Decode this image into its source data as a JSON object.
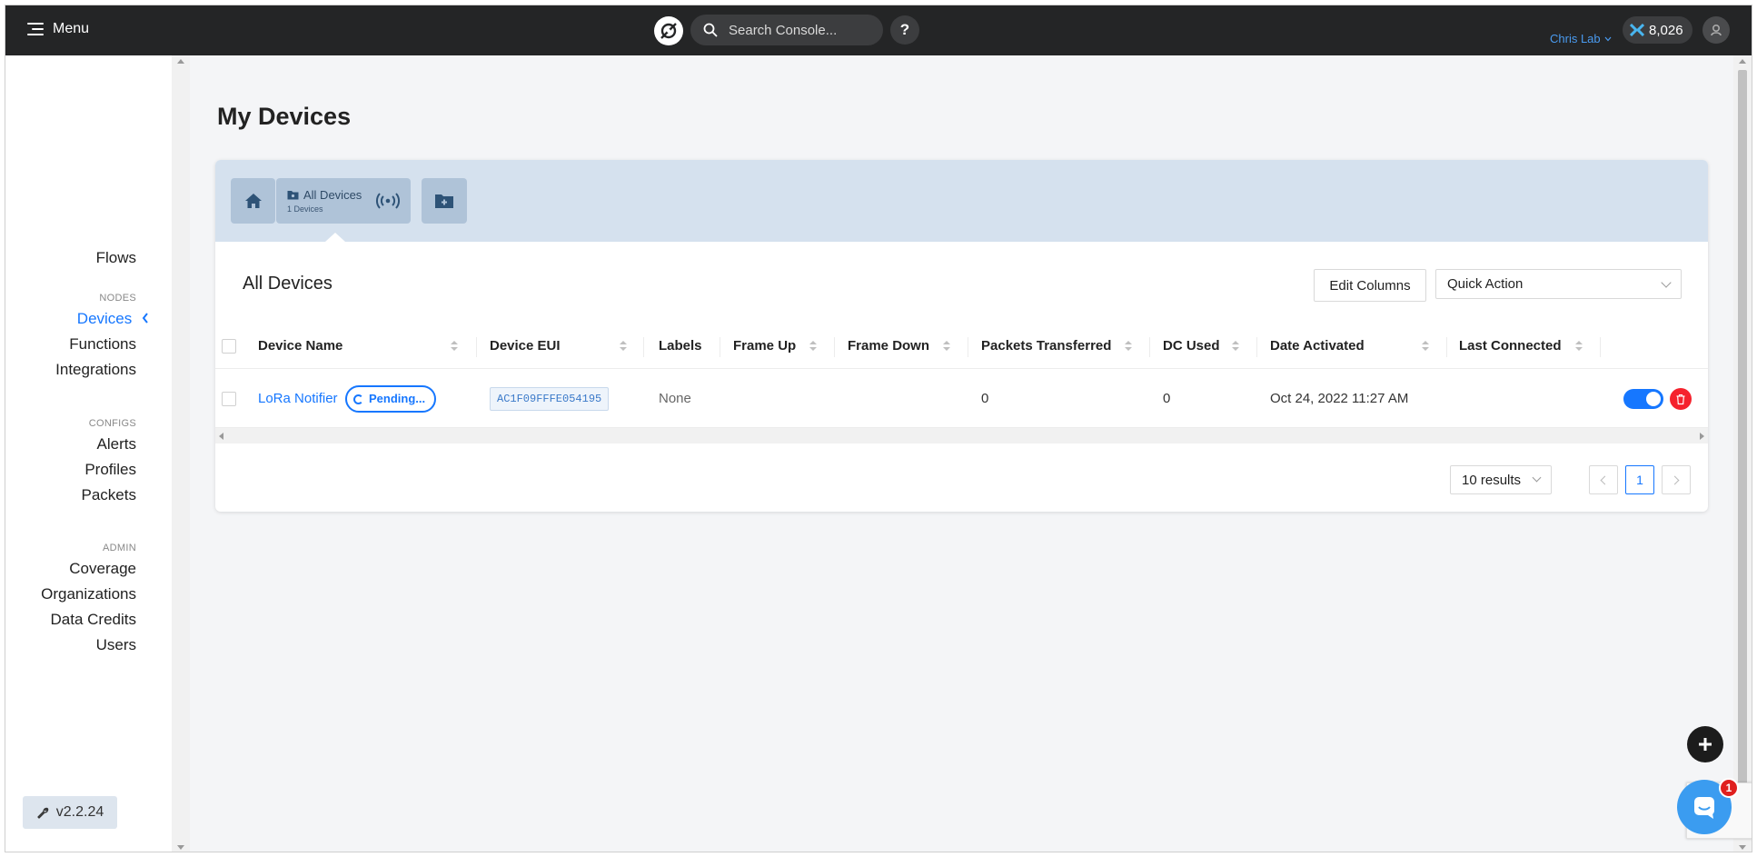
{
  "topbar": {
    "menu_label": "Menu",
    "search_placeholder": "Search Console...",
    "help_label": "?",
    "org_name": "Chris Lab",
    "dc_balance": "8,026"
  },
  "sidebar": {
    "groups": [
      {
        "heading": "",
        "items": [
          {
            "label": "Flows",
            "active": false
          }
        ]
      },
      {
        "heading": "NODES",
        "items": [
          {
            "label": "Devices",
            "active": true
          },
          {
            "label": "Functions",
            "active": false
          },
          {
            "label": "Integrations",
            "active": false
          }
        ]
      },
      {
        "heading": "CONFIGS",
        "items": [
          {
            "label": "Alerts",
            "active": false
          },
          {
            "label": "Profiles",
            "active": false
          },
          {
            "label": "Packets",
            "active": false
          }
        ]
      },
      {
        "heading": "ADMIN",
        "items": [
          {
            "label": "Coverage",
            "active": false
          },
          {
            "label": "Organizations",
            "active": false
          },
          {
            "label": "Data Credits",
            "active": false
          },
          {
            "label": "Users",
            "active": false
          }
        ]
      }
    ],
    "version": "v2.2.24"
  },
  "main": {
    "page_title": "My Devices",
    "toolbar": {
      "all_devices_label": "All Devices",
      "all_devices_count": "1 Devices"
    },
    "section_title": "All Devices",
    "edit_columns_label": "Edit Columns",
    "quick_action_label": "Quick Action",
    "table": {
      "columns": [
        "Device Name",
        "Device EUI",
        "Labels",
        "Frame Up",
        "Frame Down",
        "Packets Transferred",
        "DC Used",
        "Date Activated",
        "Last Connected"
      ],
      "rows": [
        {
          "device_name": "LoRa Notifier",
          "status": "Pending...",
          "device_eui": "AC1F09FFFE054195",
          "labels": "None",
          "frame_up": "",
          "frame_down": "",
          "packets_transferred": "0",
          "dc_used": "0",
          "date_activated": "Oct 24, 2022 11:27 AM",
          "last_connected": "",
          "active": true
        }
      ]
    },
    "pagination": {
      "page_size_label": "10 results",
      "current_page": "1"
    }
  },
  "colors": {
    "accent": "#1677ff",
    "topbar_bg": "#242526",
    "toolbar_bg": "#d5e1ee",
    "danger": "#f5222d"
  },
  "chat_badge_count": "1"
}
